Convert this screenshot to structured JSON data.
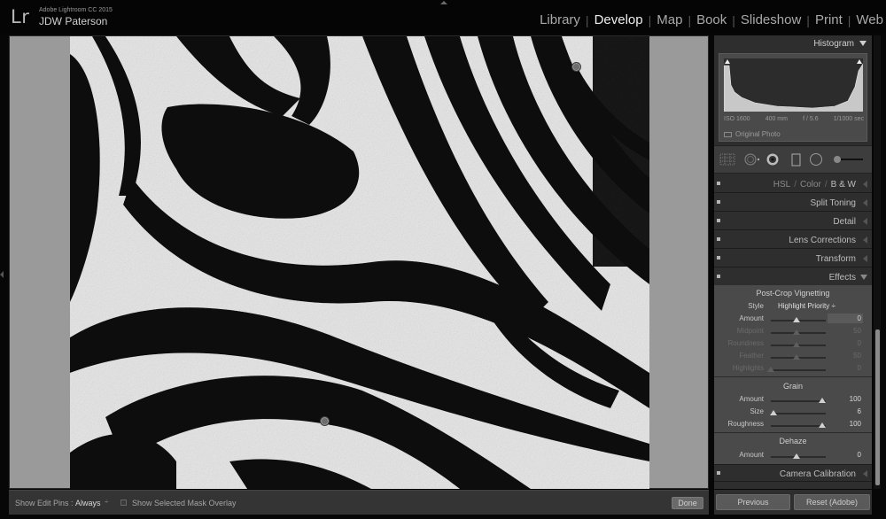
{
  "header": {
    "logo": "Lr",
    "app_title": "Adobe Lightroom CC 2015",
    "user_name": "JDW Paterson",
    "modules": [
      "Library",
      "Develop",
      "Map",
      "Book",
      "Slideshow",
      "Print",
      "Web"
    ],
    "active_module": "Develop"
  },
  "view": {
    "edit_pins": 2
  },
  "toolbar": {
    "show_edit_pins_label": "Show Edit Pins :",
    "show_edit_pins_value": "Always",
    "dropdown_glyph": "÷",
    "mask_overlay_label": "Show Selected Mask Overlay",
    "mask_overlay_checked": false,
    "done_label": "Done"
  },
  "histogram": {
    "title": "Histogram",
    "iso": "ISO 1600",
    "focal_length": "400 mm",
    "aperture": "f / 5.6",
    "shutter": "1/1000 sec",
    "original_photo_label": "Original Photo",
    "original_photo_checked": false
  },
  "tools": [
    "crop-overlay-icon",
    "spot-removal-icon",
    "red-eye-icon",
    "graduated-filter-icon",
    "radial-filter-icon",
    "adjustment-brush-icon"
  ],
  "sections": {
    "hsl": {
      "hsl": "HSL",
      "sep": "/",
      "color": "Color",
      "bw": "B & W"
    },
    "split_toning": "Split Toning",
    "detail": "Detail",
    "lens_corrections": "Lens Corrections",
    "transform": "Transform",
    "effects": "Effects",
    "camera_calibration": "Camera Calibration"
  },
  "effects": {
    "vignetting_title": "Post-Crop Vignetting",
    "style_label": "Style",
    "style_value": "Highlight Priority ÷",
    "vignette_rows": [
      {
        "label": "Amount",
        "value": "0",
        "fraction": 0.5,
        "dim": false
      },
      {
        "label": "Midpoint",
        "value": "50",
        "fraction": 0.5,
        "dim": true
      },
      {
        "label": "Roundness",
        "value": "0",
        "fraction": 0.5,
        "dim": true
      },
      {
        "label": "Feather",
        "value": "50",
        "fraction": 0.5,
        "dim": true
      },
      {
        "label": "Highlights",
        "value": "0",
        "fraction": 0.0,
        "dim": true
      }
    ],
    "grain_title": "Grain",
    "grain_rows": [
      {
        "label": "Amount",
        "value": "100",
        "fraction": 1.0
      },
      {
        "label": "Size",
        "value": "6",
        "fraction": 0.06
      },
      {
        "label": "Roughness",
        "value": "100",
        "fraction": 1.0
      }
    ],
    "dehaze_title": "Dehaze",
    "dehaze_rows": [
      {
        "label": "Amount",
        "value": "0",
        "fraction": 0.5
      }
    ]
  },
  "bottom_buttons": {
    "previous": "Previous",
    "reset": "Reset (Adobe)"
  }
}
